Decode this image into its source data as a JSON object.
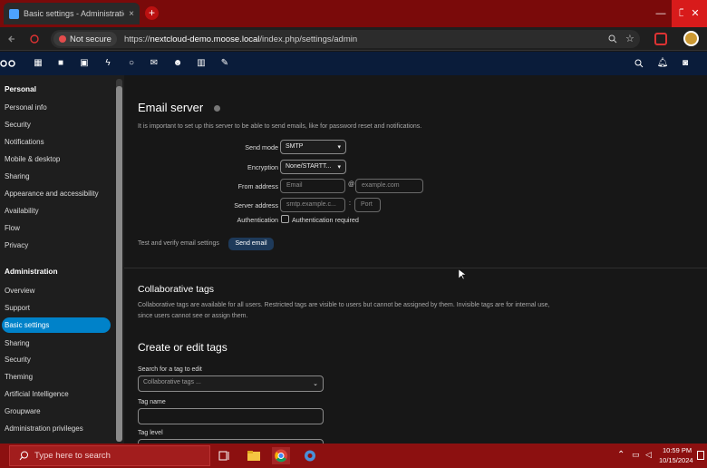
{
  "browser": {
    "tab_title": "Basic settings - Administration",
    "tab_close": "×",
    "new_tab": "+",
    "security_label": "Not secure",
    "url_scheme": "https://",
    "url_host": "nextcloud-demo.moose.local",
    "url_path": "/index.php/settings/admin",
    "window_minimize": "—",
    "window_restore": "❐",
    "window_close": "✕",
    "colors": {
      "tabstrip": "#7a0a0a",
      "close_button": "#d81b1b"
    }
  },
  "sidebar": {
    "personal_heading": "Personal",
    "personal_items": [
      {
        "label": "Personal info"
      },
      {
        "label": "Security"
      },
      {
        "label": "Notifications"
      },
      {
        "label": "Mobile & desktop"
      },
      {
        "label": "Sharing"
      },
      {
        "label": "Appearance and accessibility"
      },
      {
        "label": "Availability"
      },
      {
        "label": "Flow"
      },
      {
        "label": "Privacy"
      }
    ],
    "admin_heading": "Administration",
    "admin_items": [
      {
        "label": "Overview"
      },
      {
        "label": "Support"
      },
      {
        "label": "Basic settings"
      },
      {
        "label": "Sharing"
      },
      {
        "label": "Security"
      },
      {
        "label": "Theming"
      },
      {
        "label": "Artificial Intelligence"
      },
      {
        "label": "Groupware"
      },
      {
        "label": "Administration privileges"
      }
    ],
    "active_item": "Basic settings",
    "accent": "#0082c9"
  },
  "email_server": {
    "title": "Email server",
    "description": "It is important to set up this server to be able to send emails, like for password reset and notifications.",
    "send_mode_label": "Send mode",
    "send_mode_value": "SMTP",
    "encryption_label": "Encryption",
    "encryption_value": "None/STARTT...",
    "from_address_label": "From address",
    "from_address_placeholder": "Email",
    "at_sign": "@",
    "domain_placeholder": "example.com",
    "server_address_label": "Server address",
    "server_placeholder": "smtp.example.c...",
    "colon": ":",
    "port_placeholder": "Port",
    "authentication_label": "Authentication",
    "authentication_checkbox_label": "Authentication required",
    "test_label": "Test and verify email settings",
    "send_email_button": "Send email"
  },
  "collaborative_tags": {
    "title": "Collaborative tags",
    "description": "Collaborative tags are available for all users. Restricted tags are visible to users but cannot be assigned by them. Invisible tags are for internal use, since users cannot see or assign them.",
    "create_title": "Create or edit tags",
    "search_label": "Search for a tag to edit",
    "search_placeholder": "Collaborative tags ...",
    "tag_name_label": "Tag name",
    "tag_level_label": "Tag level"
  },
  "taskbar": {
    "search_placeholder": "Type here to search",
    "time": "10:59 PM",
    "date": "10/15/2024",
    "color": "#8c1010"
  }
}
